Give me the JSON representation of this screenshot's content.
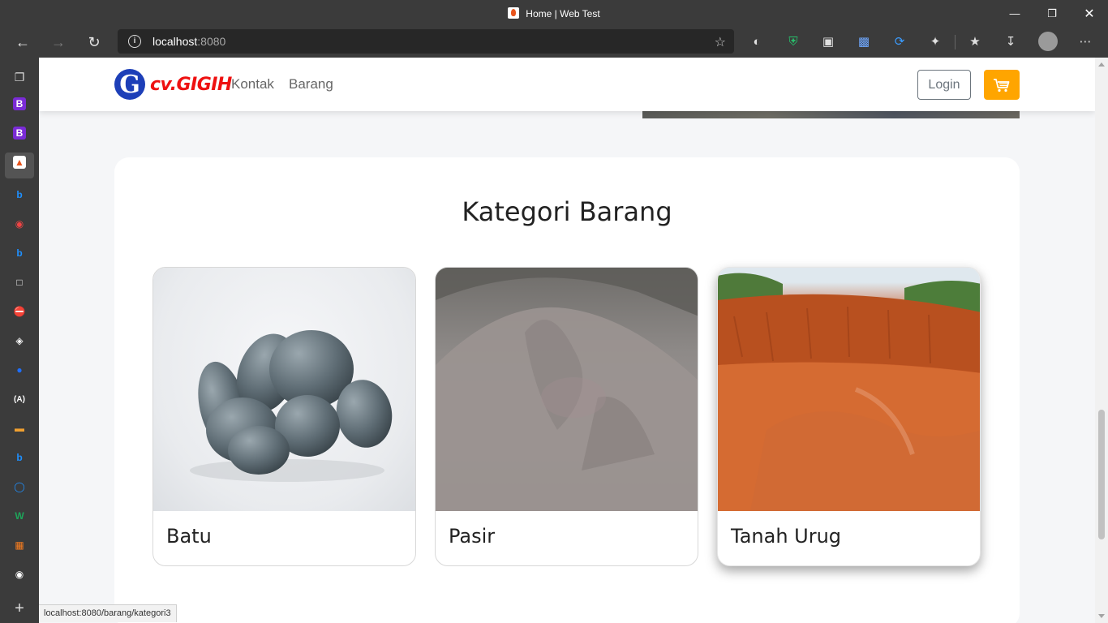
{
  "browser": {
    "tab_title": "Home | Web Test",
    "url_host": "localhost",
    "url_port": ":8080",
    "status_url": "localhost:8080/barang/kategori3"
  },
  "site": {
    "logo_letter": "G",
    "logo_text": "cv.GIGIH",
    "nav": [
      "Kontak",
      "Barang"
    ],
    "login_label": "Login"
  },
  "section": {
    "title": "Kategori Barang",
    "items": [
      {
        "label": "Batu"
      },
      {
        "label": "Pasir"
      },
      {
        "label": "Tanah Urug"
      }
    ]
  },
  "colors": {
    "cart_button": "#ffa500",
    "logo_blue": "#1d3fb8",
    "logo_red": "#ee1111"
  }
}
